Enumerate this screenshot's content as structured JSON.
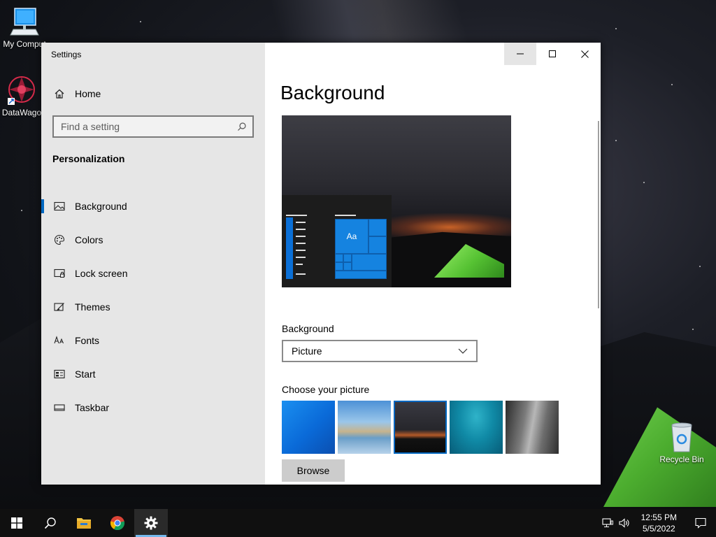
{
  "desktop": {
    "icons": [
      {
        "label": "My Comput"
      },
      {
        "label": "DataWago"
      },
      {
        "label": "Recycle Bin"
      }
    ]
  },
  "window": {
    "title": "Settings",
    "sidebar": {
      "home_label": "Home",
      "search_placeholder": "Find a setting",
      "section_title": "Personalization",
      "items": [
        {
          "label": "Background",
          "icon": "picture-icon",
          "active": true
        },
        {
          "label": "Colors",
          "icon": "palette-icon",
          "active": false
        },
        {
          "label": "Lock screen",
          "icon": "lock-screen-icon",
          "active": false
        },
        {
          "label": "Themes",
          "icon": "themes-icon",
          "active": false
        },
        {
          "label": "Fonts",
          "icon": "fonts-icon",
          "active": false
        },
        {
          "label": "Start",
          "icon": "start-icon",
          "active": false
        },
        {
          "label": "Taskbar",
          "icon": "taskbar-icon",
          "active": false
        }
      ]
    },
    "content": {
      "page_title": "Background",
      "preview_tile_text": "Aa",
      "background_label": "Background",
      "background_value": "Picture",
      "choose_label": "Choose your picture",
      "browse_label": "Browse"
    }
  },
  "taskbar": {
    "time": "12:55 PM",
    "date": "5/5/2022"
  },
  "colors": {
    "accent": "#0067c0",
    "sidebar_bg": "#e6e6e6",
    "taskbar_bg": "#101010"
  }
}
